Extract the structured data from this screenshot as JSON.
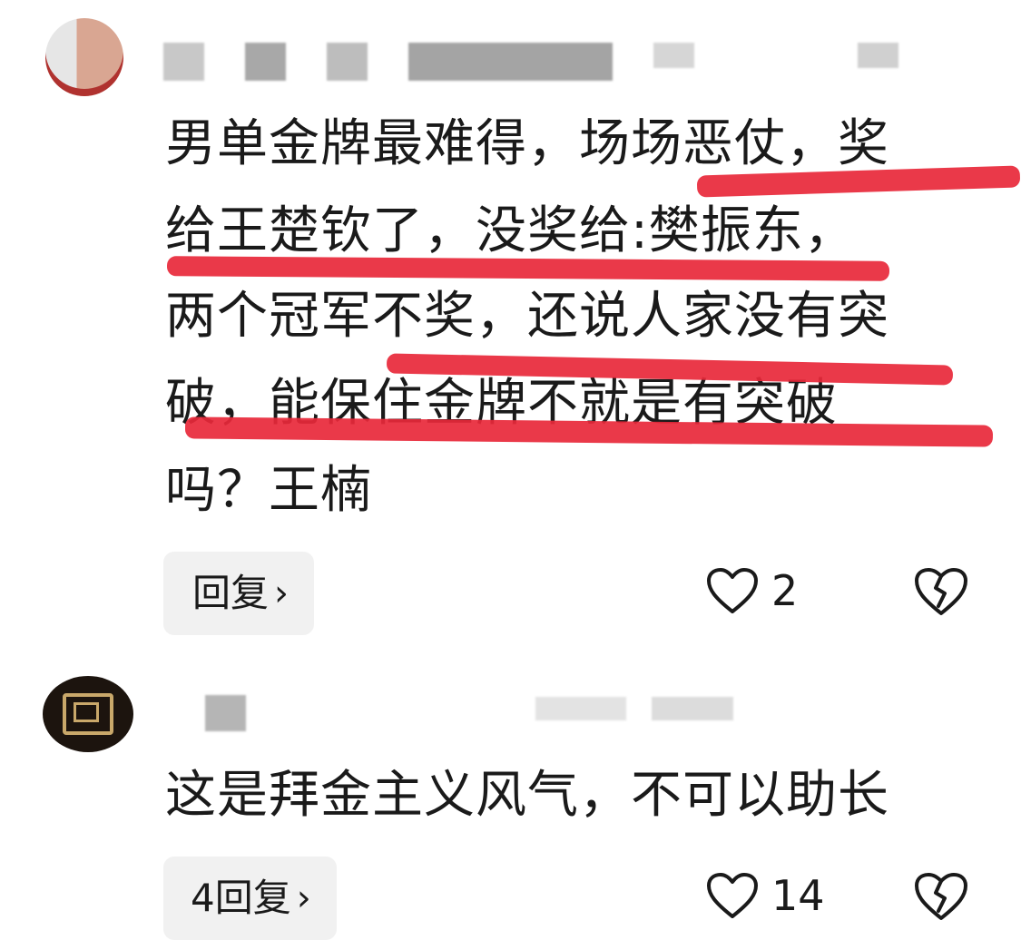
{
  "comments": [
    {
      "text_lines": [
        "男单金牌最难得，场场恶仗，奖",
        "给王楚钦了，没奖给:樊振东，",
        "两个冠军不奖，还说人家没有突",
        "破，能保住金牌不就是有突破",
        "吗？王楠"
      ],
      "reply_label": "回复",
      "reply_chevron": "›",
      "like_count": "2",
      "like_icon": "heart-outline-icon",
      "dislike_icon": "broken-heart-icon"
    },
    {
      "text_lines": [
        "这是拜金主义风气，不可以助长"
      ],
      "reply_label": "4回复",
      "reply_chevron": "›",
      "like_count": "14",
      "like_icon": "heart-outline-icon",
      "dislike_icon": "broken-heart-icon"
    }
  ],
  "colors": {
    "highlight_line": "#e8283a",
    "reply_bg": "#f1f1f1",
    "text": "#1a1a1a"
  }
}
